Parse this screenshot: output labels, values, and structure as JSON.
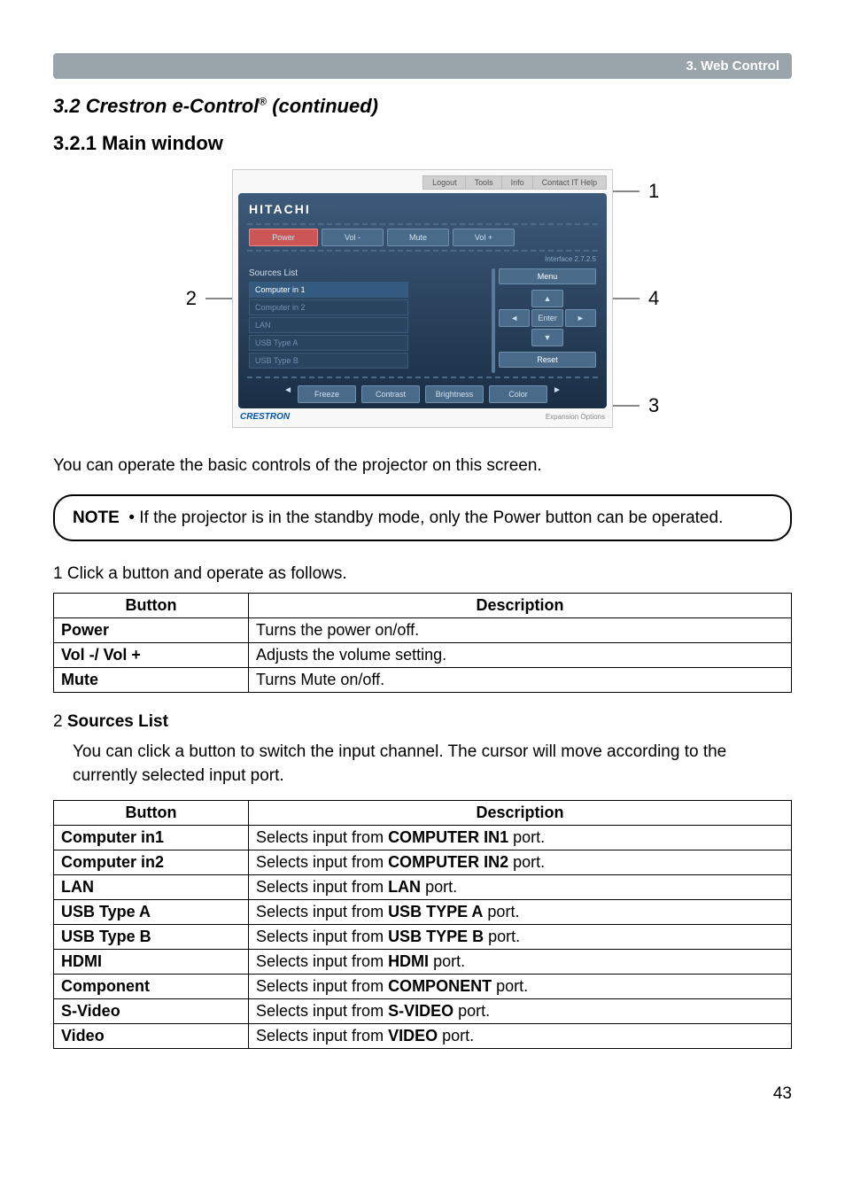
{
  "header_bar": "3. Web Control",
  "section_title_prefix": "3.2 Crestron e-Control",
  "section_title_suffix": " (continued)",
  "subsection_title": "3.2.1 Main window",
  "callouts": {
    "c1": "1",
    "c2": "2",
    "c3": "3",
    "c4": "4"
  },
  "screenshot": {
    "tabs": {
      "logout": "Logout",
      "tools": "Tools",
      "info": "Info",
      "contact": "Contact IT Help"
    },
    "logo": "HITACHI",
    "top_buttons": {
      "power": "Power",
      "vol_down": "Vol -",
      "mute": "Mute",
      "vol_up": "Vol +"
    },
    "version": "Interface 2.7.2.5",
    "sources_title": "Sources List",
    "sources": [
      "Computer in 1",
      "Computer in 2",
      "LAN",
      "USB Type A",
      "USB Type B"
    ],
    "menu": "Menu",
    "enter": "Enter",
    "reset": "Reset",
    "bottom_buttons": {
      "freeze": "Freeze",
      "contrast": "Contrast",
      "brightness": "Brightness",
      "color": "Color"
    },
    "footer_left": "CRESTRON",
    "footer_right": "Expansion Options"
  },
  "body_text": "You can operate the basic controls of the projector on this screen.",
  "note": {
    "label": "NOTE",
    "bullet": "• If the projector is in the standby mode, only the Power button can be operated."
  },
  "list1_intro": "1 Click a button and operate as follows.",
  "table1": {
    "h1": "Button",
    "h2": "Description",
    "rows": [
      {
        "btn": "Power",
        "desc": "Turns the power on/off."
      },
      {
        "btn": "Vol -/ Vol +",
        "desc": "Adjusts the volume setting."
      },
      {
        "btn": "Mute",
        "desc": "Turns Mute on/off."
      }
    ]
  },
  "list2_num": "2 ",
  "list2_title": "Sources List",
  "list2_text": "You can click a button to switch the input channel. The cursor will move according to the currently selected input port.",
  "table2": {
    "h1": "Button",
    "h2": "Description",
    "rows": [
      {
        "btn": "Computer in1",
        "d1": "Selects input from ",
        "bold": "COMPUTER IN1",
        "d2": " port."
      },
      {
        "btn": "Computer in2",
        "d1": "Selects input from ",
        "bold": "COMPUTER IN2",
        "d2": " port."
      },
      {
        "btn": "LAN",
        "d1": "Selects input from ",
        "bold": "LAN",
        "d2": " port."
      },
      {
        "btn": "USB Type A",
        "d1": "Selects input from ",
        "bold": "USB TYPE A",
        "d2": " port."
      },
      {
        "btn": "USB Type B",
        "d1": "Selects input from ",
        "bold": "USB TYPE B",
        "d2": " port."
      },
      {
        "btn": "HDMI",
        "d1": "Selects input from ",
        "bold": "HDMI",
        "d2": " port."
      },
      {
        "btn": "Component",
        "d1": "Selects input from ",
        "bold": "COMPONENT",
        "d2": " port."
      },
      {
        "btn": "S-Video",
        "d1": "Selects input from ",
        "bold": "S-VIDEO",
        "d2": " port."
      },
      {
        "btn": "Video",
        "d1": "Selects input from ",
        "bold": "VIDEO",
        "d2": " port."
      }
    ]
  },
  "page_num": "43"
}
